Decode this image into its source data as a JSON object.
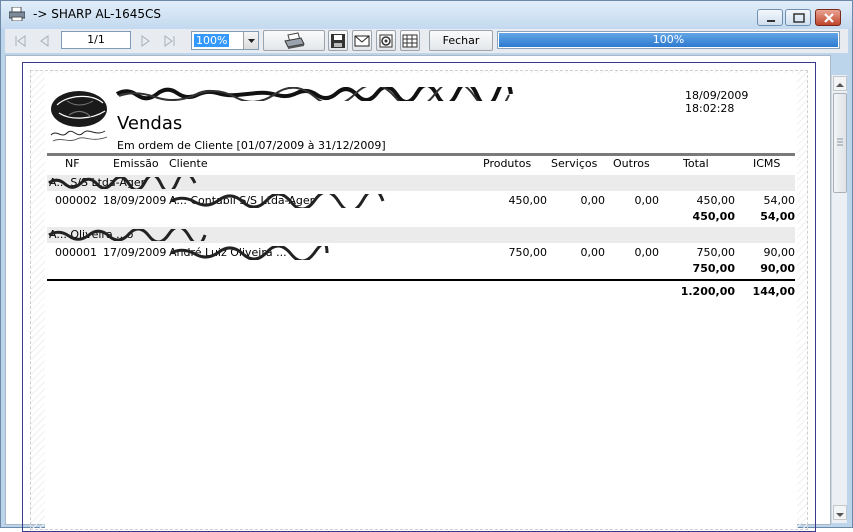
{
  "window": {
    "title": "-> SHARP AL-1645CS"
  },
  "toolbar": {
    "page_indicator": "1/1",
    "zoom": "100%",
    "close_label": "Fechar",
    "progress_label": "100%",
    "progress_value": 1.0,
    "icons": [
      "first-page-icon",
      "prev-page-icon",
      "next-page-icon",
      "last-page-icon",
      "printer-icon",
      "save-icon",
      "email-icon",
      "print-setup-icon",
      "grid-icon"
    ]
  },
  "report": {
    "company": "",
    "datetime": "18/09/2009 18:02:28",
    "title": "Vendas",
    "subtitle": "Em ordem de Cliente [01/07/2009 à 31/12/2009]",
    "columns": [
      "NF",
      "Emissão",
      "Cliente",
      "Produtos",
      "Serviços",
      "Outros",
      "Total",
      "ICMS"
    ],
    "groups": [
      {
        "label": "A... S/S Ltda-Ager",
        "rows": [
          {
            "nf": "000002",
            "emissao": "18/09/2009",
            "cliente": "A... Contabil S/S Ltda-Ager",
            "produtos": "450,00",
            "servicos": "0,00",
            "outros": "0,00",
            "total": "450,00",
            "icms": "54,00"
          }
        ],
        "subtotal": {
          "total": "450,00",
          "icms": "54,00"
        }
      },
      {
        "label": "A... Oliveira ...o",
        "rows": [
          {
            "nf": "000001",
            "emissao": "17/09/2009",
            "cliente": "André Luiz Oliveira ...",
            "produtos": "750,00",
            "servicos": "0,00",
            "outros": "0,00",
            "total": "750,00",
            "icms": "90,00"
          }
        ],
        "subtotal": {
          "total": "750,00",
          "icms": "90,00"
        }
      }
    ],
    "grand_total": {
      "total": "1.200,00",
      "icms": "144,00"
    }
  },
  "colors": {
    "titlebar": "#c3d9ef",
    "progress": "#2c79cf",
    "band": "#ebebeb"
  }
}
